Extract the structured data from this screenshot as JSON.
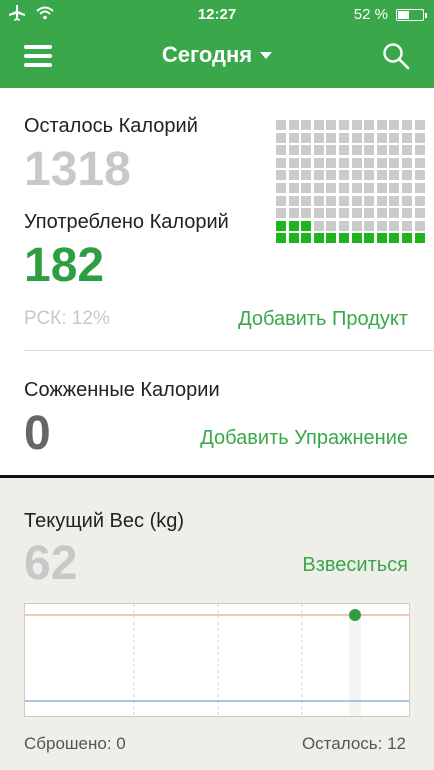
{
  "status": {
    "time": "12:27",
    "battery": "52 %",
    "battery_level": 0.52
  },
  "header": {
    "title": "Сегодня"
  },
  "calories": {
    "remaining_label": "Осталось Калорий",
    "remaining_value": "1318",
    "consumed_label": "Употреблено Калорий",
    "consumed_value": "182",
    "rsk_label": "РСК: 12%",
    "add_food": "Добавить Продукт",
    "grid": {
      "cols": 12,
      "rows": 10,
      "filled": 15
    }
  },
  "burned": {
    "label": "Сожженные Калории",
    "value": "0",
    "add_exercise": "Добавить Упражнение"
  },
  "weight": {
    "label": "Текущий Вес (kg)",
    "value": "62",
    "weigh_in": "Взвеситься",
    "lost": "Сброшено: 0",
    "remaining": "Осталось: 12"
  },
  "colors": {
    "accent": "#3aa84a",
    "consumed": "#2f9e42",
    "grid_on": "#1fb41f",
    "grid_off": "#cbcbcb",
    "goal_line": "#e9b79a",
    "start_line": "#8fb4d9"
  }
}
